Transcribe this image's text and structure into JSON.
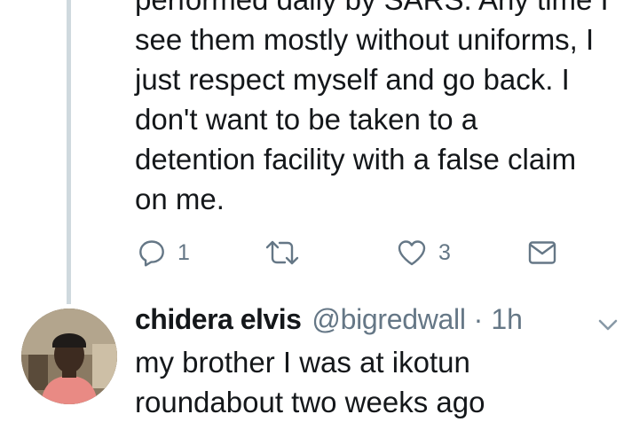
{
  "tweet1": {
    "text_lines": [
      "performed daily by SARS. Any time I",
      "see them mostly without uniforms, I",
      "just respect myself and go back. I",
      "don't want to be taken to a",
      "detention facility with a false claim",
      "on me."
    ],
    "reply_count": "1",
    "like_count": "3"
  },
  "tweet2": {
    "display_name": "chidera elvis",
    "handle": "@bigredwall",
    "separator": "·",
    "time": "1h",
    "text_lines": [
      "my brother I was at ikotun",
      "roundabout two weeks ago"
    ]
  },
  "icons": {
    "reply": "reply-icon",
    "retweet": "retweet-icon",
    "like": "heart-icon",
    "dm": "envelope-icon",
    "more": "chevron-down-icon"
  },
  "colors": {
    "text": "#14171a",
    "secondary": "#657786",
    "thread_line": "#cfd9de",
    "background": "#ffffff"
  }
}
